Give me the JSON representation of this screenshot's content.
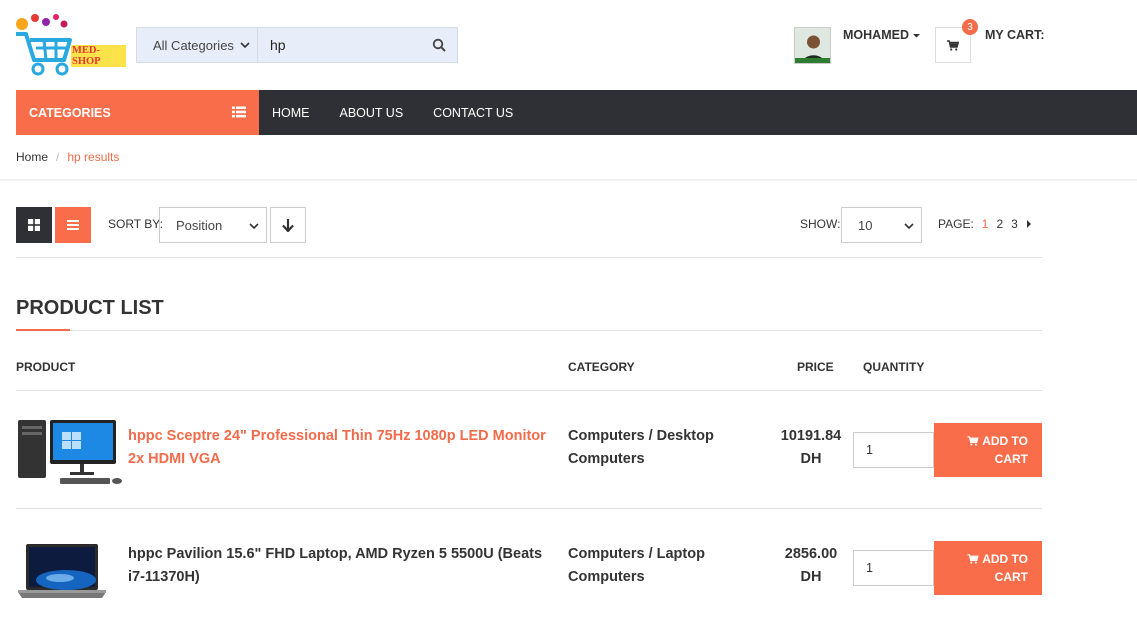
{
  "brand": {
    "logo_text": "MED-SHOP"
  },
  "search": {
    "category": "All Categories",
    "query": "hp"
  },
  "user": {
    "name": "MOHAMED"
  },
  "cart": {
    "count": "3",
    "label": "MY CART:"
  },
  "nav": {
    "categories_label": "CATEGORIES",
    "links": [
      "HOME",
      "ABOUT US",
      "CONTACT US"
    ]
  },
  "breadcrumb": {
    "home": "Home",
    "sep": "/",
    "current": "hp results"
  },
  "toolbar": {
    "sort_label": "SORT BY:",
    "sort_value": "Position",
    "show_label": "SHOW:",
    "show_value": "10",
    "page_label": "PAGE:",
    "pages": [
      "1",
      "2",
      "3"
    ],
    "current_page": "1"
  },
  "product_list": {
    "title": "PRODUCT LIST",
    "headers": {
      "product": "PRODUCT",
      "category": "CATEGORY",
      "price": "PRICE",
      "quantity": "QUANTITY"
    },
    "add_label_1": "ADD TO",
    "add_label_2": "CART",
    "items": [
      {
        "name_line1": "hppc Sceptre 24\" Professional Thin 75Hz 1080p LED Monitor",
        "name_line2": "2x HDMI VGA",
        "category_line1": "Computers / Desktop",
        "category_line2": "Computers",
        "price": "10191.84",
        "currency": "DH",
        "quantity": "1"
      },
      {
        "name_line1": "hppc Pavilion 15.6\" FHD Laptop, AMD Ryzen 5 5500U (Beats",
        "name_line2": "i7-11370H)",
        "category_line1": "Computers / Laptop",
        "category_line2": "Computers",
        "price": "2856.00",
        "currency": "DH",
        "quantity": "1"
      }
    ]
  },
  "colors": {
    "accent": "#f96d4b",
    "dark": "#2e3036",
    "search_bg": "#e8eef9"
  }
}
